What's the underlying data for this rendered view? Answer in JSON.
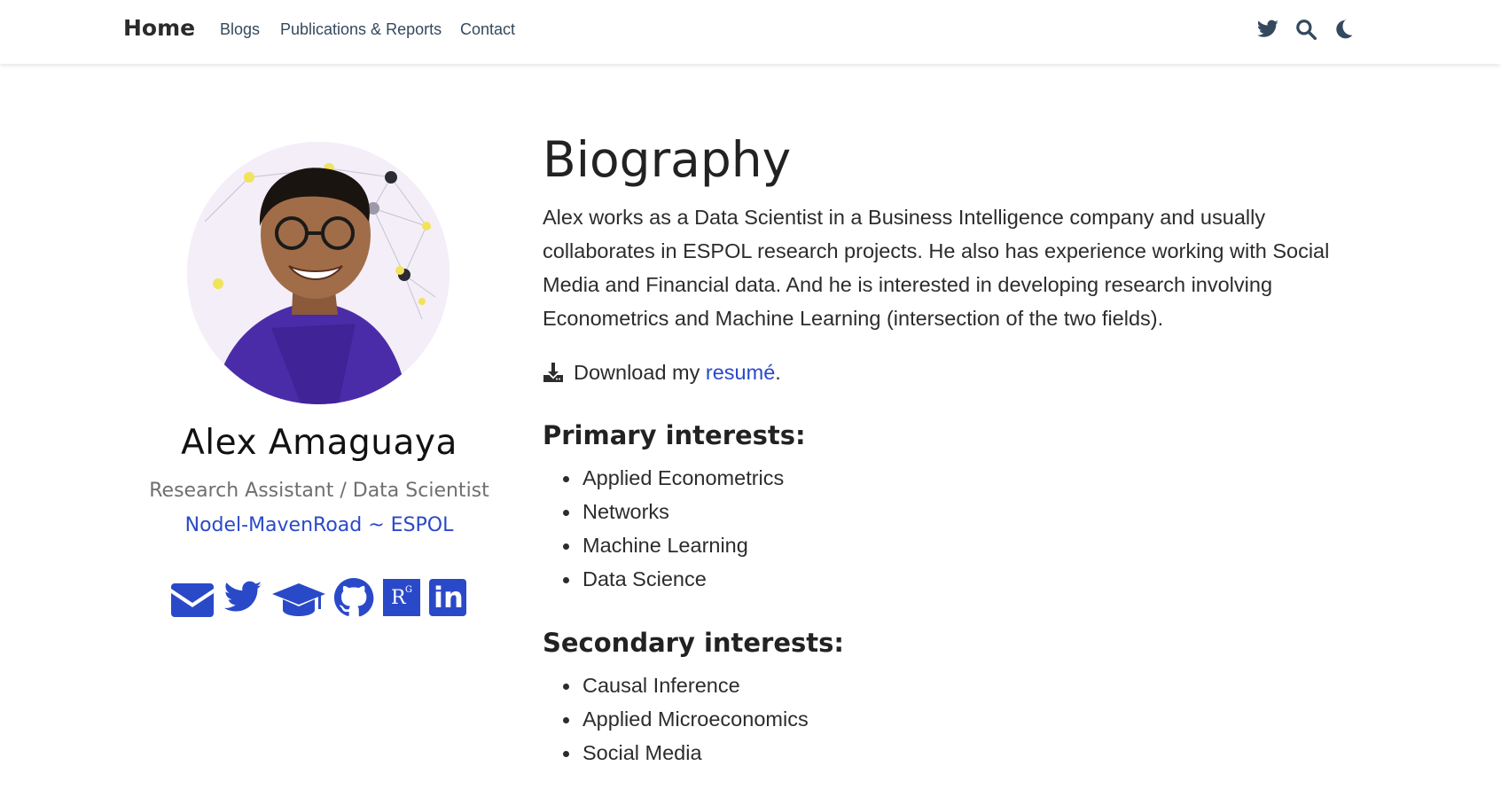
{
  "navbar": {
    "brand": "Home",
    "links": [
      "Blogs",
      "Publications & Reports",
      "Contact"
    ],
    "icons": [
      "twitter-icon",
      "search-icon",
      "moon-icon"
    ]
  },
  "profile": {
    "name": "Alex Amaguaya",
    "role": "Research Assistant / Data Scientist",
    "organization": "Nodel-MavenRoad ~ ESPOL",
    "social_icons": [
      "envelope-icon",
      "twitter-icon",
      "graduation-cap-icon",
      "github-icon",
      "researchgate-icon",
      "linkedin-icon"
    ],
    "researchgate_label": "R",
    "researchgate_sup": "G",
    "linkedin_label": "in"
  },
  "biography": {
    "title": "Biography",
    "text": "Alex works as a Data Scientist in a Business Intelligence company and usually collaborates in ESPOL research projects. He also has experience working with Social Media and Financial data. And he is interested in developing research involving Econometrics and Machine Learning (intersection of the two fields).",
    "download_prefix": "Download my ",
    "download_link": "resumé",
    "download_suffix": "."
  },
  "primary_interests": {
    "title": "Primary interests:",
    "items": [
      "Applied Econometrics",
      "Networks",
      "Machine Learning",
      "Data Science"
    ]
  },
  "secondary_interests": {
    "title": "Secondary interests:",
    "items": [
      "Causal Inference",
      "Applied Microeconomics",
      "Social Media"
    ]
  },
  "colors": {
    "accent": "#2a49c9",
    "nav_text": "#34495e",
    "text": "#2c2c2c"
  }
}
